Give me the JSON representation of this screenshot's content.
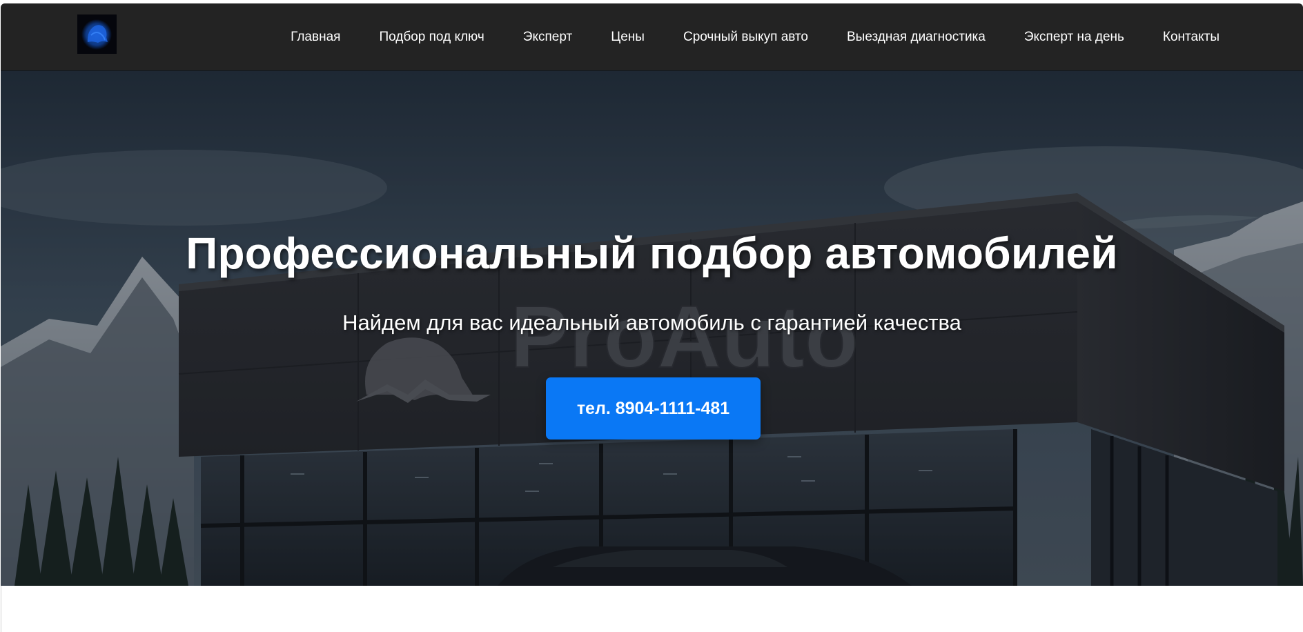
{
  "header": {
    "logo_icon": "bear-logo-icon",
    "nav": [
      {
        "label": "Главная"
      },
      {
        "label": "Подбор под ключ"
      },
      {
        "label": "Эксперт"
      },
      {
        "label": "Цены"
      },
      {
        "label": "Срочный выкуп авто"
      },
      {
        "label": "Выездная диагностика"
      },
      {
        "label": "Эксперт на день"
      },
      {
        "label": "Контакты"
      }
    ]
  },
  "hero": {
    "title": "Профессиональный подбор автомобилей",
    "subtitle": "Найдем для вас идеальный автомобиль с гарантией качества",
    "cta_label": "тел. 8904-1111-481",
    "background_sign_text": "ProAuto",
    "background_icon": "bear-mountain-sign-icon"
  },
  "colors": {
    "header_bg": "#232323",
    "nav_text": "#ffffff",
    "cta_bg": "#0a78f5",
    "logo_accent": "#1a5fd0"
  }
}
